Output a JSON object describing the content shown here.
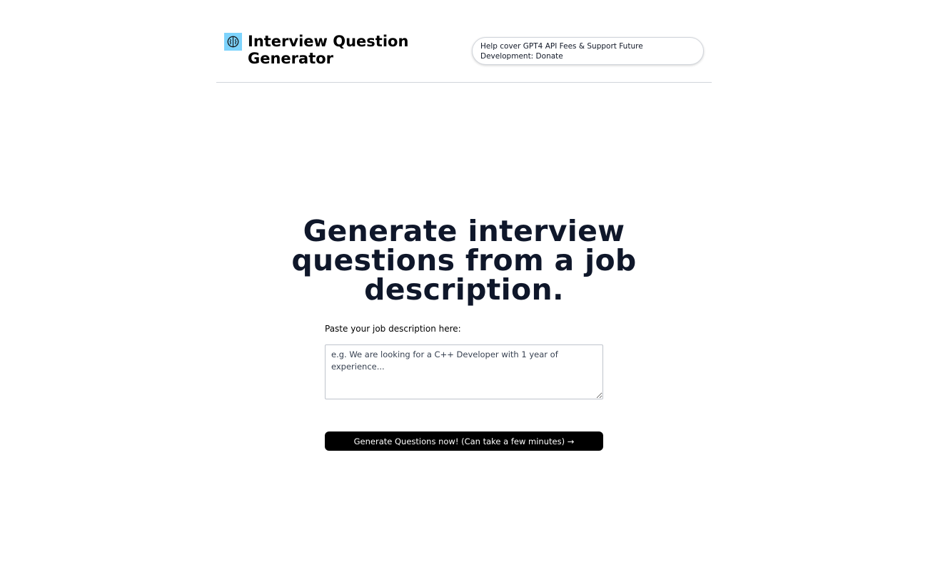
{
  "header": {
    "logo_icon": "brain-icon",
    "title": "Interview Question Generator",
    "donate_text": "Help cover GPT4 API Fees & Support Future Development: Donate"
  },
  "main": {
    "heading": "Generate interview questions from a job description.",
    "input_label": "Paste your job description here:",
    "textarea_placeholder": "e.g. We are looking for a C++ Developer with 1 year of experience...",
    "generate_button": "Generate Questions now! (Can take a few minutes) →"
  },
  "colors": {
    "logo_bg": "#7dd3fc",
    "button_bg": "#000000",
    "heading": "#0f172a"
  }
}
